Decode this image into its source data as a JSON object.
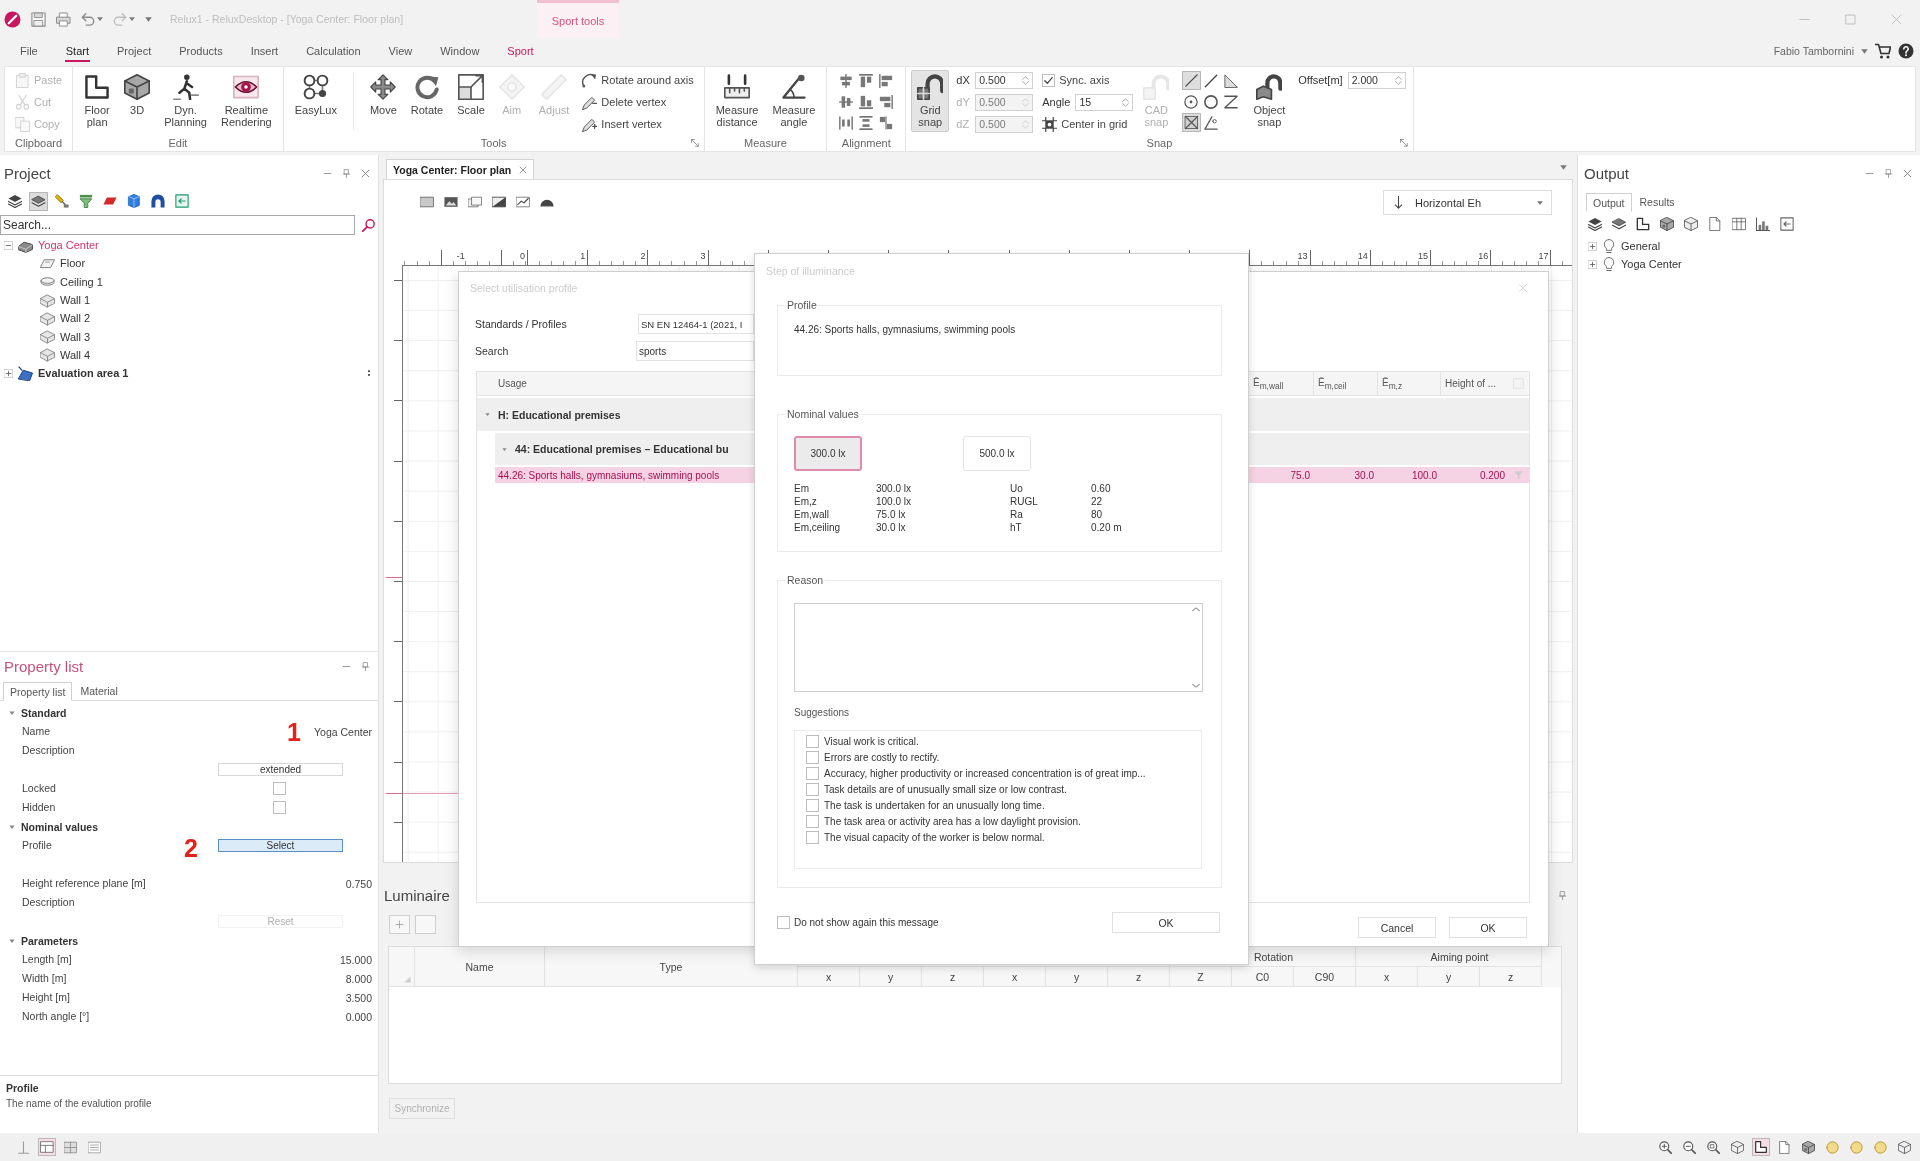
{
  "title_bar": {
    "title": "Relux1 - ReluxDesktop - [Yoga Center: Floor plan]",
    "context_group": "Sport tools"
  },
  "menu_tabs": [
    {
      "label": "File",
      "kind": "standard",
      "selected": false
    },
    {
      "label": "Start",
      "kind": "standard",
      "selected": true
    },
    {
      "label": "Project",
      "kind": "standard",
      "selected": false
    },
    {
      "label": "Products",
      "kind": "standard",
      "selected": false
    },
    {
      "label": "Insert",
      "kind": "standard",
      "selected": false
    },
    {
      "label": "Calculation",
      "kind": "standard",
      "selected": false
    },
    {
      "label": "View",
      "kind": "standard",
      "selected": false
    },
    {
      "label": "Window",
      "kind": "standard",
      "selected": false
    },
    {
      "label": "Sport",
      "kind": "contextual",
      "selected": false
    }
  ],
  "user": {
    "name": "Fabio Tambornini"
  },
  "ribbon": [
    {
      "label": "Clipboard",
      "launcher": false,
      "items": [
        {
          "kind": "stack",
          "rows": [
            {
              "kind": "small",
              "label": "Paste",
              "disabled": true
            },
            {
              "kind": "small",
              "label": "Cut",
              "disabled": true
            },
            {
              "kind": "small",
              "label": "Copy",
              "disabled": true
            }
          ]
        }
      ]
    },
    {
      "label": "Edit",
      "launcher": false,
      "items": [
        {
          "kind": "large",
          "label": "Floor plan",
          "selected": false,
          "disabled": false
        },
        {
          "kind": "large",
          "label": "3D",
          "selected": false,
          "disabled": false
        },
        {
          "kind": "large",
          "label": "Dyn. Planning",
          "selected": false,
          "disabled": false
        },
        {
          "kind": "large",
          "label": "Realtime Rendering",
          "selected": false,
          "disabled": false
        }
      ]
    },
    {
      "label": "Tools",
      "launcher": true,
      "items": [
        {
          "kind": "large",
          "label": "EasyLux",
          "selected": false,
          "disabled": false
        },
        {
          "kind": "separator"
        },
        {
          "kind": "large",
          "label": "Move",
          "selected": false,
          "disabled": false
        },
        {
          "kind": "large",
          "label": "Rotate",
          "selected": false,
          "disabled": false
        },
        {
          "kind": "large",
          "label": "Scale",
          "selected": false,
          "disabled": false
        },
        {
          "kind": "large",
          "label": "Aim",
          "selected": false,
          "disabled": true
        },
        {
          "kind": "large",
          "label": "Adjust",
          "selected": false,
          "disabled": true
        },
        {
          "kind": "stack",
          "rows": [
            {
              "kind": "small",
              "label": "Rotate around axis",
              "disabled": false
            },
            {
              "kind": "small",
              "label": "Delete vertex",
              "disabled": false
            },
            {
              "kind": "small",
              "label": "Insert vertex",
              "disabled": false
            }
          ]
        }
      ]
    },
    {
      "label": "Measure",
      "launcher": false,
      "items": [
        {
          "kind": "large",
          "label": "Measure distance",
          "selected": false,
          "disabled": false
        },
        {
          "kind": "large",
          "label": "Measure angle",
          "selected": false,
          "disabled": false
        }
      ]
    },
    {
      "label": "Alignment",
      "launcher": false,
      "items": [
        {
          "kind": "icon_grid"
        }
      ]
    },
    {
      "label": "Snap",
      "launcher": true,
      "items": [
        {
          "kind": "large",
          "label": "Grid snap",
          "selected": true,
          "disabled": false
        },
        {
          "kind": "stack",
          "rows": [
            {
              "kind": "spin",
              "label": "dX",
              "value": "0.500",
              "disabled": false
            },
            {
              "kind": "spin",
              "label": "dY",
              "value": "0.500",
              "disabled": true
            },
            {
              "kind": "spin",
              "label": "dZ",
              "value": "0.500",
              "disabled": true
            }
          ]
        },
        {
          "kind": "stack",
          "rows": [
            {
              "kind": "check",
              "label": "Sync. axis",
              "checked": true,
              "disabled": false
            },
            {
              "kind": "spin",
              "label": "Angle",
              "value": "15",
              "disabled": false
            },
            {
              "kind": "small",
              "label": "Center in grid",
              "disabled": false
            }
          ]
        },
        {
          "kind": "large",
          "label": "CAD snap",
          "selected": false,
          "disabled": true
        },
        {
          "kind": "icon_grid",
          "cells": [
            {
              "selected": true
            },
            {
              "selected": false
            },
            {
              "selected": false
            },
            {
              "selected": false
            },
            {
              "selected": false
            },
            {
              "selected": false
            },
            {
              "selected": true
            },
            {
              "selected": false
            }
          ]
        },
        {
          "kind": "large",
          "label": "Object snap",
          "selected": false,
          "disabled": false
        },
        {
          "kind": "stack",
          "rows": [
            {
              "kind": "spin",
              "label": "Offset[m]",
              "value": "2.000",
              "disabled": false
            }
          ]
        }
      ]
    }
  ],
  "project": {
    "title": "Project",
    "toolbar": [
      {
        "selected": false
      },
      {
        "selected": true
      },
      {
        "selected": false
      },
      {
        "selected": false
      },
      {
        "selected": false
      },
      {
        "selected": false
      },
      {
        "selected": false
      },
      {
        "selected": false
      }
    ],
    "search": {
      "placeholder": "Search..."
    },
    "tree": [
      {
        "label": "Yoga Center",
        "kind": "room",
        "selected": true,
        "expanded": true,
        "children": [
          {
            "label": "Floor",
            "kind": "floor",
            "selected": false
          },
          {
            "label": "Ceiling 1",
            "kind": "ceiling",
            "selected": false
          },
          {
            "label": "Wall 1",
            "kind": "wall",
            "selected": false
          },
          {
            "label": "Wall 2",
            "kind": "wall",
            "selected": false
          },
          {
            "label": "Wall 3",
            "kind": "wall",
            "selected": false
          },
          {
            "label": "Wall 4",
            "kind": "wall",
            "selected": false
          }
        ]
      },
      {
        "label": "Evaluation area 1",
        "kind": "evaluation_area",
        "selected": false,
        "expanded": false
      }
    ]
  },
  "property_list": {
    "title": "Property list",
    "tabs": [
      {
        "label": "Property list",
        "selected": true
      },
      {
        "label": "Material",
        "selected": false
      }
    ],
    "rows": [
      {
        "kind": "section",
        "label": "Standard",
        "expanded": true
      },
      {
        "kind": "text",
        "label": "Name",
        "value": "Yoga Center",
        "callout": "1"
      },
      {
        "kind": "text",
        "label": "Description"
      },
      {
        "kind": "button",
        "button": "extended",
        "focused": false,
        "disabled": false
      },
      {
        "kind": "check",
        "label": "Locked",
        "checked": false
      },
      {
        "kind": "check",
        "label": "Hidden",
        "checked": false
      },
      {
        "kind": "section",
        "label": "Nominal values",
        "expanded": true
      },
      {
        "kind": "button",
        "label": "Profile",
        "button": "Select",
        "focused": true,
        "disabled": false,
        "callout": "2"
      },
      {
        "kind": "text",
        "label": "Height reference plane [m]",
        "value": "0.750"
      },
      {
        "kind": "text",
        "label": "Description"
      },
      {
        "kind": "button",
        "button": "Reset",
        "focused": false,
        "disabled": true
      },
      {
        "kind": "section",
        "label": "Parameters",
        "expanded": true
      },
      {
        "kind": "text",
        "label": "Length [m]",
        "value": "15.000"
      },
      {
        "kind": "text",
        "label": "Width [m]",
        "value": "8.000"
      },
      {
        "kind": "text",
        "label": "Height [m]",
        "value": "3.500"
      },
      {
        "kind": "text",
        "label": "North angle [°]",
        "value": "0.000"
      }
    ],
    "help": {
      "title": "Profile",
      "text": "The name of the evalution profile"
    }
  },
  "document": {
    "tabs": [
      {
        "label": "Yoga Center: Floor plan",
        "selected": true
      }
    ],
    "view": {
      "value": "Horizontal Eh"
    },
    "ruler": {
      "left_labels": [
        "-1",
        "0",
        "1",
        "2",
        "3"
      ],
      "right_labels": [
        "13",
        "14",
        "15",
        "16",
        "17"
      ]
    }
  },
  "luminaires": {
    "title": "Luminaire",
    "columns": [
      "Name",
      "Type"
    ],
    "sub_columns": [
      "x",
      "y",
      "z",
      "x",
      "y",
      "z"
    ],
    "column_groups": [
      {
        "label": "Rotation",
        "columns": [
          "Z",
          "C0",
          "C90"
        ]
      },
      {
        "label": "Aiming point",
        "columns": [
          "x",
          "y",
          "z"
        ]
      }
    ],
    "synchronize": {
      "label": "Synchronize",
      "disabled": true
    }
  },
  "output": {
    "title": "Output",
    "tabs": [
      {
        "label": "Output",
        "selected": true
      },
      {
        "label": "Results",
        "selected": false
      }
    ],
    "tree": [
      {
        "label": "General",
        "expanded": false
      },
      {
        "label": "Yoga Center",
        "expanded": false
      }
    ]
  },
  "status_bar": {
    "view_modes": [
      {
        "selected": false
      },
      {
        "selected": true
      },
      {
        "selected": false
      },
      {
        "selected": false
      }
    ],
    "tools": [
      {
        "selected": false
      },
      {
        "selected": false
      },
      {
        "selected": false
      },
      {
        "selected": false
      },
      {
        "selected": true
      },
      {
        "selected": false
      },
      {
        "selected": false
      },
      {
        "selected": false
      },
      {
        "selected": false
      },
      {
        "selected": false
      },
      {
        "selected": false
      }
    ]
  },
  "profile_dialog": {
    "title": "Select utilisation profile",
    "fields": [
      {
        "kind": "combo",
        "label": "Standards / Profiles",
        "value": "SN EN 12464-1 (2021, I"
      },
      {
        "kind": "text",
        "label": "Search",
        "value": "sports"
      }
    ],
    "table": {
      "columns": [
        {
          "label": "Usage"
        },
        {
          "label": "Ē$_{m,wall}$"
        },
        {
          "label": "Ē$_{m,ceil}$"
        },
        {
          "label": "Ē$_{m,z}$"
        },
        {
          "label": "Height of ..."
        }
      ],
      "rows": [
        {
          "kind": "group",
          "label": "H: Educational premises",
          "expanded": true,
          "children": [
            {
              "kind": "group",
              "label": "44: Educational premises – Educational bu",
              "expanded": true,
              "children": [
                {
                  "kind": "profile",
                  "label": "44.26: Sports halls, gymnasiums, swimming pools",
                  "selected": true,
                  "values": [
                    "75.0",
                    "30.0",
                    "100.0",
                    "0.200"
                  ]
                }
              ]
            }
          ]
        }
      ]
    },
    "buttons": [
      {
        "label": "Cancel"
      },
      {
        "label": "OK"
      }
    ]
  },
  "illuminance_dialog": {
    "title": "Step of illuminance",
    "profile": {
      "label": "Profile",
      "text": "44.26: Sports halls, gymnasiums, swimming pools"
    },
    "nominal": {
      "label": "Nominal values",
      "options": [
        {
          "label": "300.0 lx",
          "selected": true
        },
        {
          "label": "500.0 lx",
          "selected": false
        }
      ],
      "value_columns": [
        {
          "items": [
            {
              "name": "Em",
              "value": "300.0 lx"
            },
            {
              "name": "Em,z",
              "value": "100.0 lx"
            },
            {
              "name": "Em,wall",
              "value": "75.0 lx"
            },
            {
              "name": "Em,ceiling",
              "value": "30.0 lx"
            }
          ]
        },
        {
          "items": [
            {
              "name": "Uo",
              "value": "0.60"
            },
            {
              "name": "RUGL",
              "value": "22"
            },
            {
              "name": "Ra",
              "value": "80"
            },
            {
              "name": "hT",
              "value": "0.20 m"
            }
          ]
        }
      ]
    },
    "reason": {
      "label": "Reason",
      "suggestions_label": "Suggestions",
      "suggestions": [
        {
          "label": "Visual work is critical.",
          "checked": false
        },
        {
          "label": "Errors are costly to rectify.",
          "checked": false
        },
        {
          "label": "Accuracy, higher productivity or increased concentration is of great imp...",
          "checked": false
        },
        {
          "label": "Task details are of unusually small size or low contrast.",
          "checked": false
        },
        {
          "label": "The task is undertaken for an unusually long time.",
          "checked": false
        },
        {
          "label": "The task area or activity area has a low daylight provision.",
          "checked": false
        },
        {
          "label": "The visual capacity of the worker is below normal.",
          "checked": false
        }
      ]
    },
    "dont_show": {
      "label": "Do not show again this message",
      "checked": false
    },
    "ok": "OK"
  }
}
